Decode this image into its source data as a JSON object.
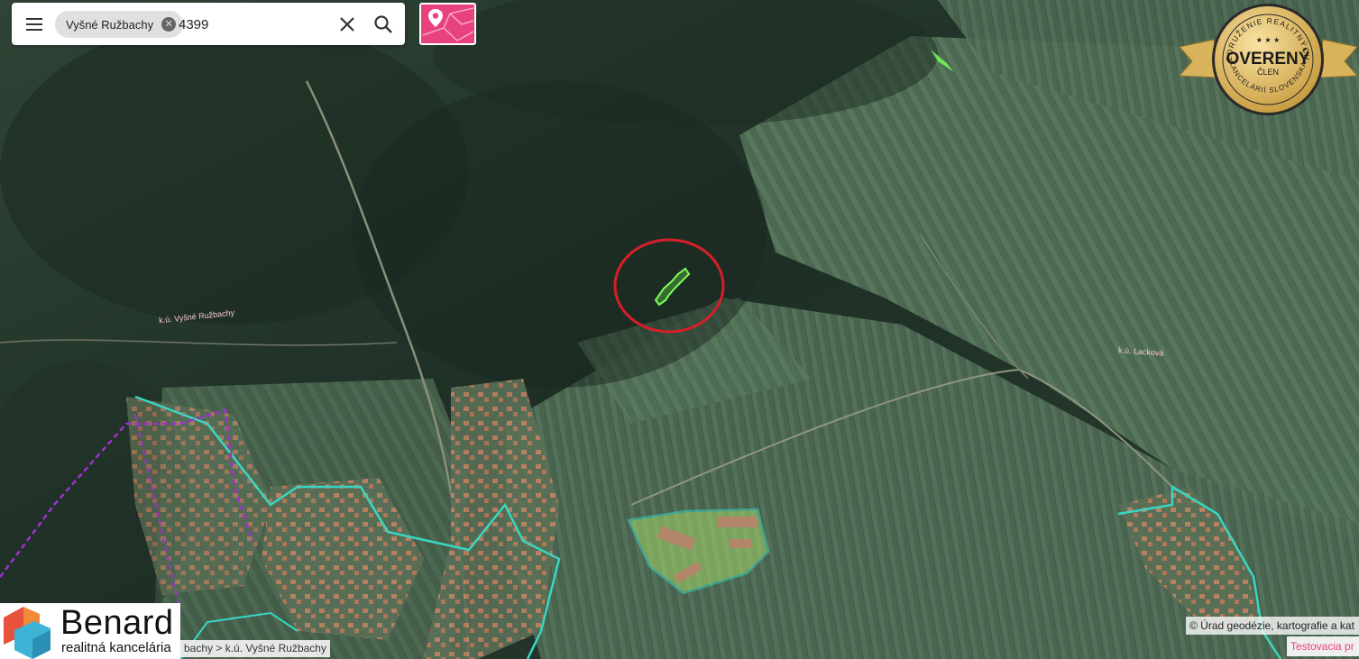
{
  "search": {
    "chip_label": "Vyšné Ružbachy",
    "query": "4399"
  },
  "map": {
    "labels": {
      "left": "k.ú. Vyšné Ružbachy",
      "right": "k.ú. Lacková"
    },
    "colors": {
      "parcel_highlight": "#7cff5a",
      "marker_circle": "#d61f2a",
      "cadastre_boundary": "#39d7c2",
      "district_boundary": "#a030d0"
    }
  },
  "badge": {
    "top_arc": "ZDRUŽENIE REALITNÝCH",
    "main": "OVERENÝ",
    "sub": "ČLEN",
    "bottom_arc": "KANCELÁRIÍ SLOVENSKA",
    "stars": "★ ★ ★"
  },
  "logo": {
    "brand": "Benard",
    "tagline": "realitná kancelária"
  },
  "breadcrumb": "bachy > k.ú. Vyšné Ružbachy",
  "attribution": "© Úrad geodézie, kartografie a kat",
  "testing": "Testovacia pr"
}
